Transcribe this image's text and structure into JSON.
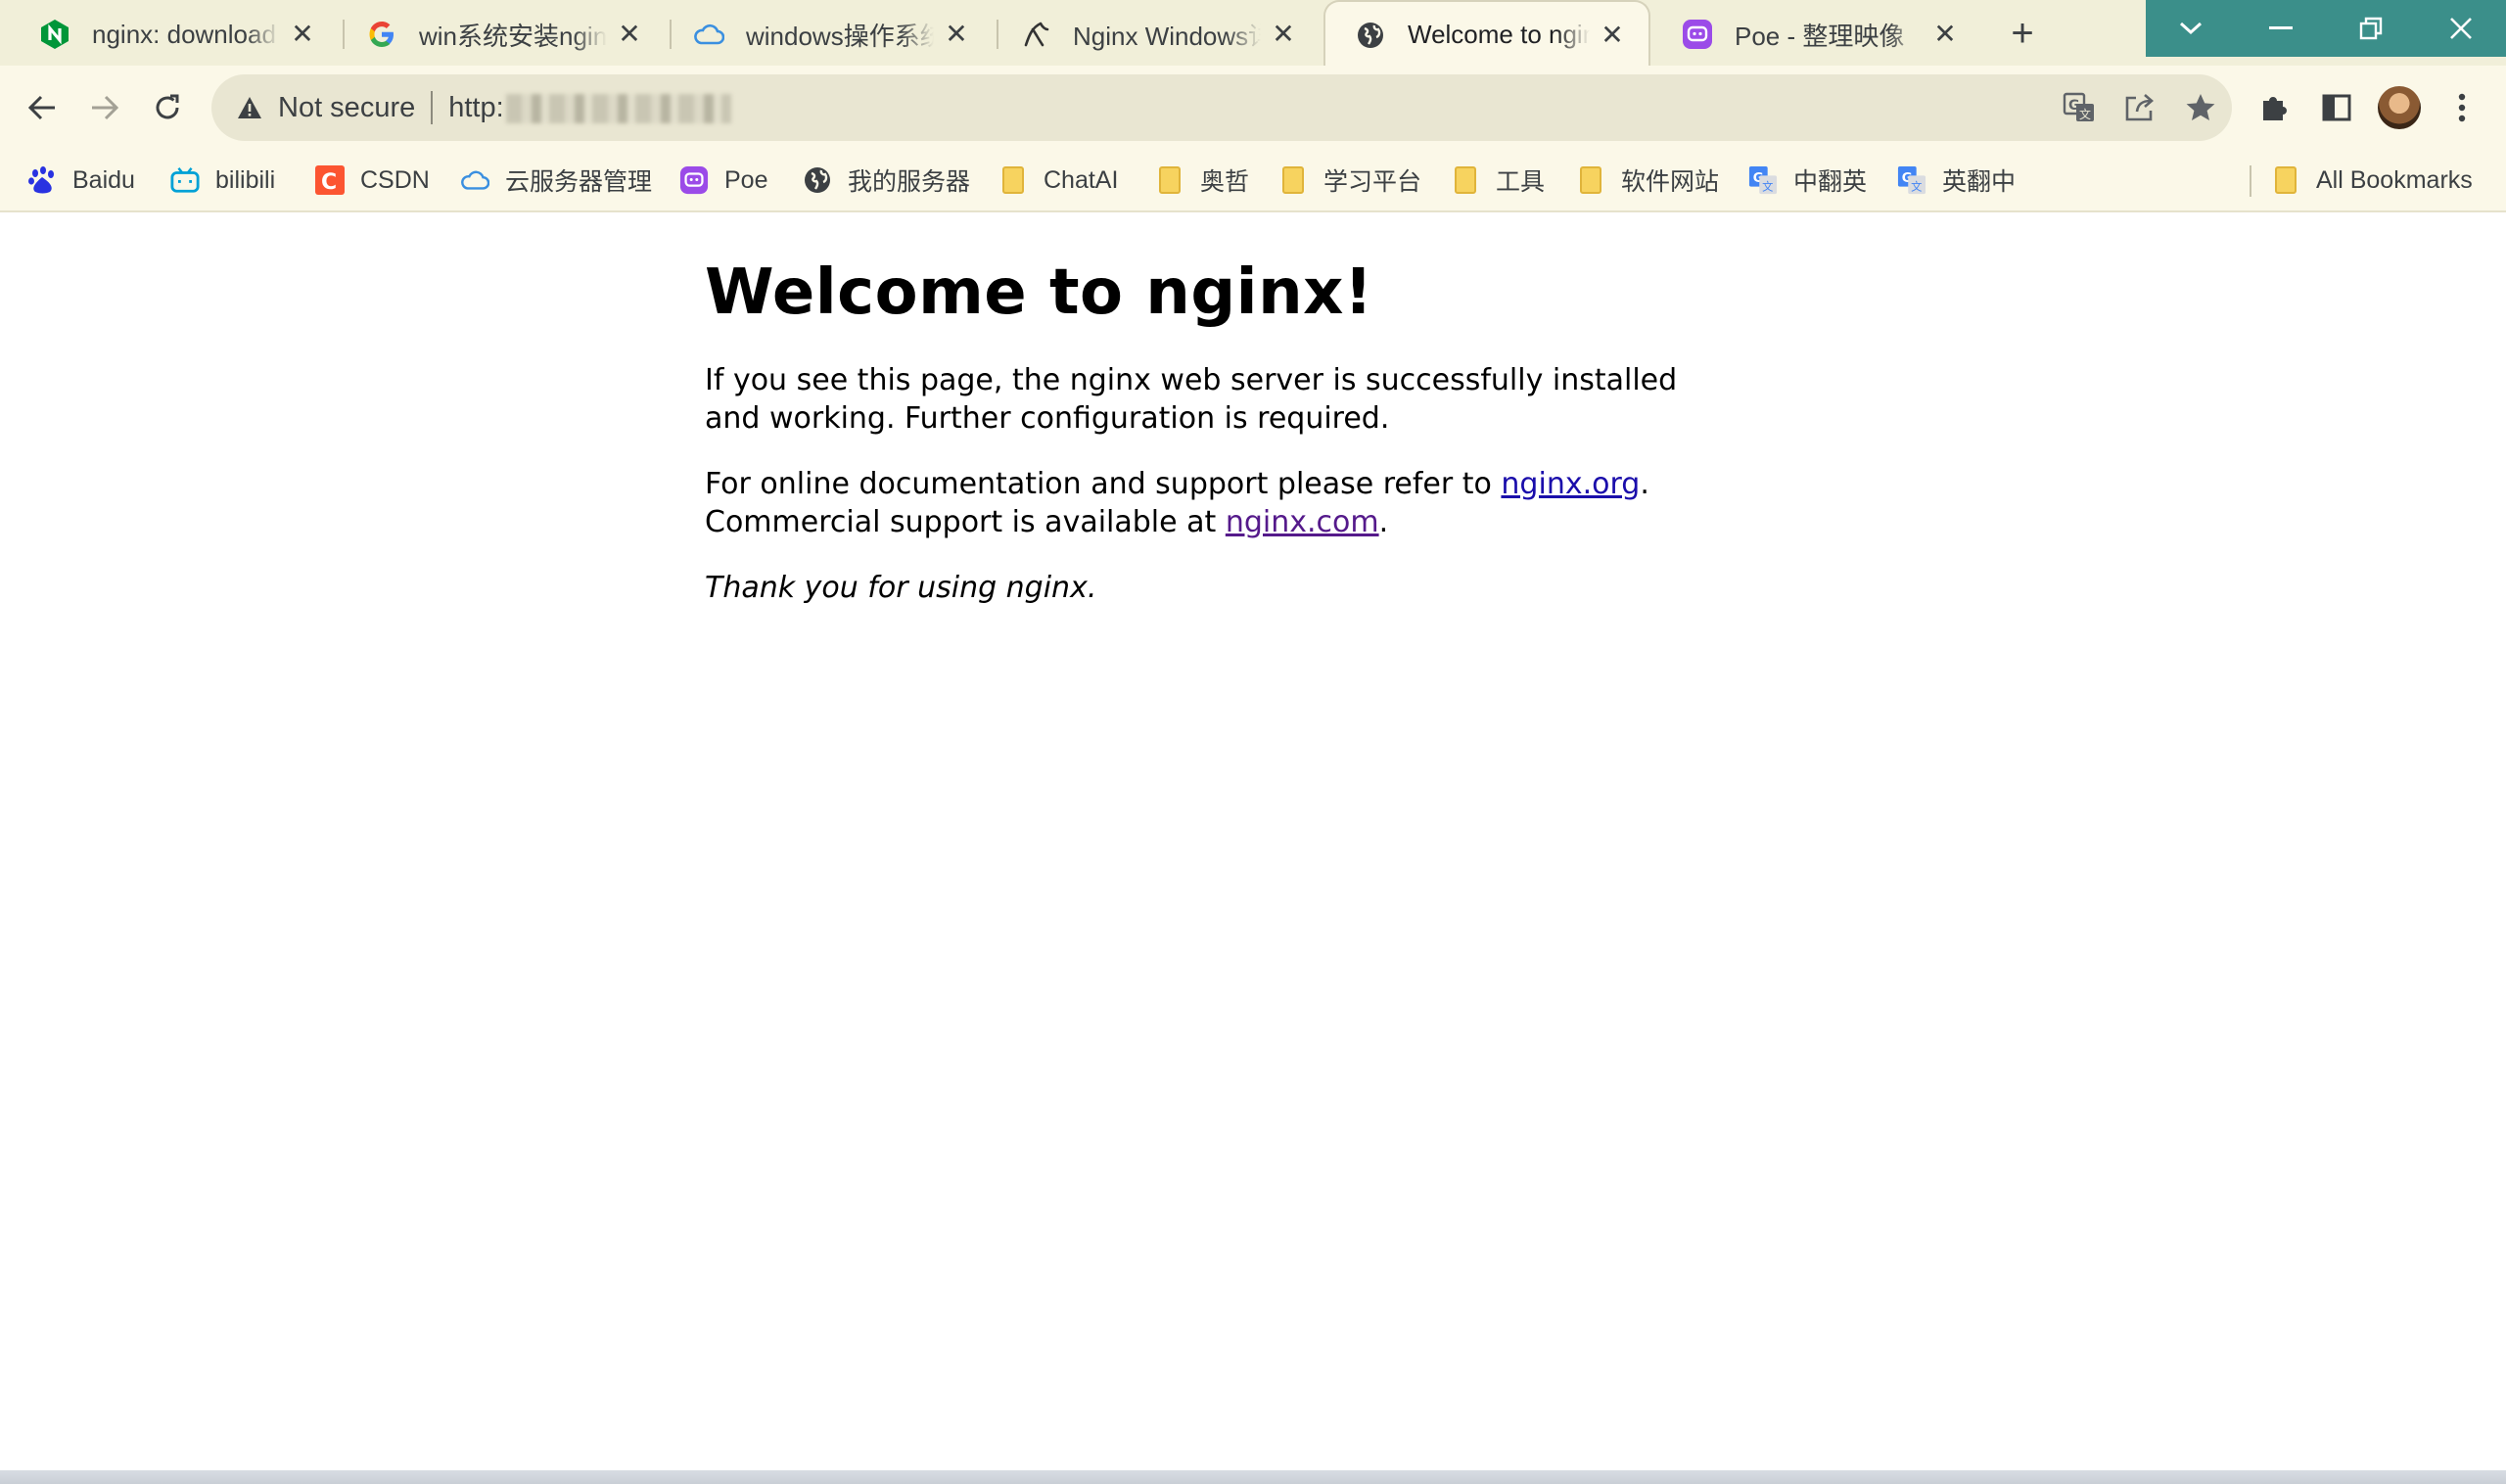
{
  "tabs": [
    {
      "title": "nginx: download",
      "icon": "nginx-icon",
      "active": false
    },
    {
      "title": "win系统安装nginx",
      "icon": "google-icon",
      "active": false
    },
    {
      "title": "windows操作系统",
      "icon": "cloud-icon",
      "active": false
    },
    {
      "title": "Nginx Windows详",
      "icon": "yuque-icon",
      "active": false
    },
    {
      "title": "Welcome to ngin",
      "icon": "globe-icon",
      "active": true
    },
    {
      "title": "Poe - 整理映像",
      "icon": "poe-icon",
      "active": false
    }
  ],
  "tab_close_glyph": "✕",
  "new_tab_glyph": "+",
  "window_controls": {
    "tab_search": "⌄",
    "minimize": "—",
    "restore": "❐",
    "close": "✕"
  },
  "omnibox": {
    "security_label": "Not secure",
    "url_prefix": "http:"
  },
  "bookmarks": [
    {
      "label": "Baidu",
      "icon": "baidu-icon"
    },
    {
      "label": "bilibili",
      "icon": "bilibili-icon"
    },
    {
      "label": "CSDN",
      "icon": "csdn-icon"
    },
    {
      "label": "云服务器管理",
      "icon": "cloud-icon"
    },
    {
      "label": "Poe",
      "icon": "poe-icon"
    },
    {
      "label": "我的服务器",
      "icon": "globe-icon"
    },
    {
      "label": "ChatAI",
      "icon": "folder-icon"
    },
    {
      "label": "奥哲",
      "icon": "folder-icon"
    },
    {
      "label": "学习平台",
      "icon": "folder-icon"
    },
    {
      "label": "工具",
      "icon": "folder-icon"
    },
    {
      "label": "软件网站",
      "icon": "folder-icon"
    },
    {
      "label": "中翻英",
      "icon": "google-translate-icon"
    },
    {
      "label": "英翻中",
      "icon": "google-translate-icon"
    }
  ],
  "all_bookmarks_label": "All Bookmarks",
  "page": {
    "heading": "Welcome to nginx!",
    "para1": "If you see this page, the nginx web server is successfully installed and working. Further configuration is required.",
    "para2_text1": "For online documentation and support please refer to ",
    "para2_link1": "nginx.org",
    "para2_text2": ".",
    "para2_text3": "Commercial support is available at ",
    "para2_link2": "nginx.com",
    "para2_text4": ".",
    "thanks": "Thank you for using nginx."
  },
  "colors": {
    "chrome_bg": "#f1efd9",
    "toolbar_bg": "#fbf8e8",
    "window_button": "#3b8f8a",
    "link": "#1a0dab",
    "link_visited": "#551a8b"
  }
}
